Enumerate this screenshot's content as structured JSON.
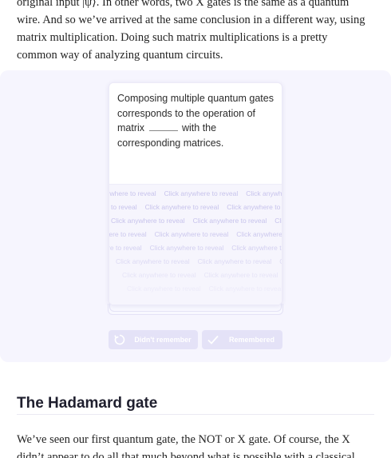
{
  "article": {
    "top_lines": [
      "original input |ψ⟩. In other words, two X gates is the same as a quantum",
      "wire. And so we’ve arrived at the same conclusion in a different way, using",
      "matrix multiplication. Doing such matrix multiplications is a pretty",
      "common way of analyzing quantum circuits."
    ],
    "section_heading": "The Hadamard gate",
    "bottom_lines": [
      "We’ve seen our first quantum gate, the NOT or X gate. Of course, the X",
      "didn’t appear to do all that much beyond what is possible with a classical"
    ]
  },
  "flashcard": {
    "prompt_part1": "Composing multiple quantum gates corresponds to the operation of matrix",
    "prompt_part2": "with the corresponding matrices.",
    "reveal_hint": "Click anywhere to reveal"
  },
  "buttons": {
    "forgot_label": "Didn't remember",
    "remember_label": "Remembered"
  },
  "colors": {
    "quiz_background": "#f6f5fe",
    "button_background": "#e4e2f7",
    "reveal_text": "#c7c3ec"
  }
}
